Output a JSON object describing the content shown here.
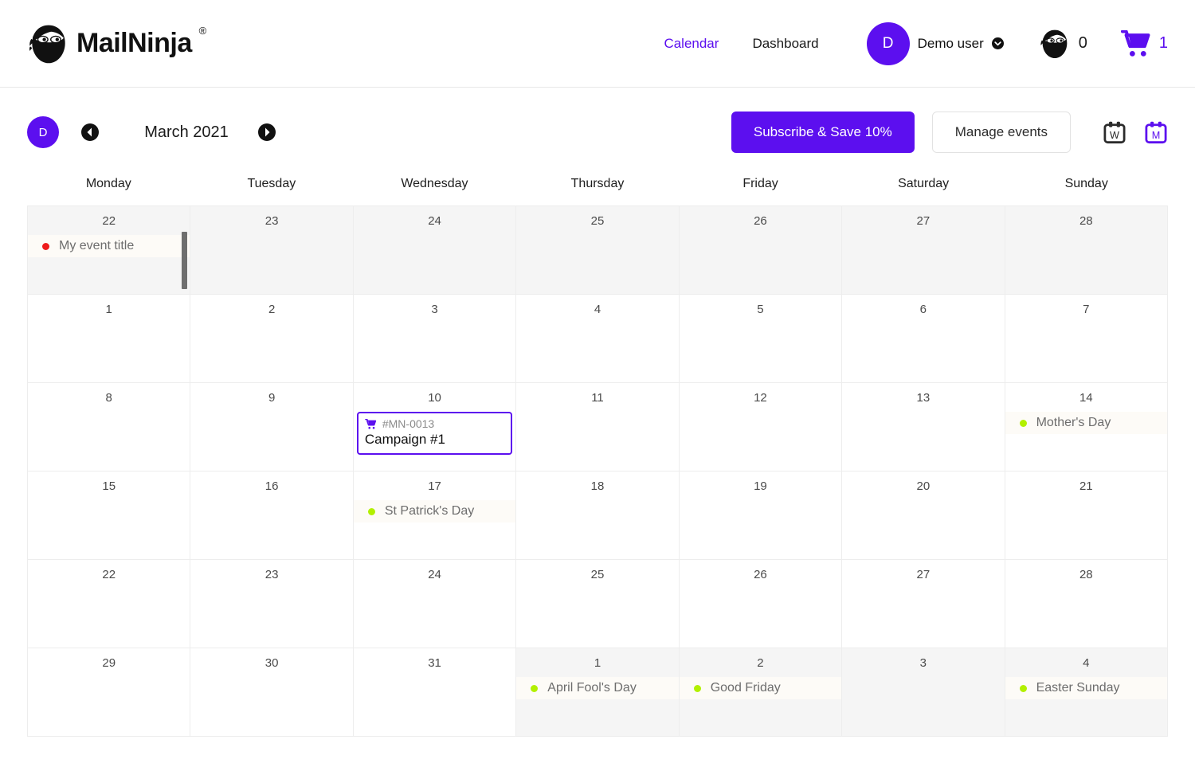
{
  "brand": {
    "name": "MailNinja",
    "trademark": "®",
    "accent": "#5c0fef"
  },
  "topnav": {
    "links": [
      {
        "label": "Calendar",
        "active": true
      },
      {
        "label": "Dashboard",
        "active": false
      }
    ],
    "avatar_initial": "D",
    "user_name": "Demo user",
    "ninja_count": "0",
    "cart_count": "1"
  },
  "toolbar": {
    "avatar_initial": "D",
    "prev_label": "Previous month",
    "next_label": "Next month",
    "month_title": "March 2021",
    "subscribe_label": "Subscribe & Save 10%",
    "manage_label": "Manage events",
    "week_view_letter": "W",
    "month_view_letter": "M",
    "active_view": "M"
  },
  "calendar": {
    "weekdays": [
      "Monday",
      "Tuesday",
      "Wednesday",
      "Thursday",
      "Friday",
      "Saturday",
      "Sunday"
    ],
    "weeks": [
      [
        {
          "num": "22",
          "muted": true,
          "scrollbar": true,
          "events": [
            {
              "kind": "holiday",
              "dot": "red",
              "title": "My event title"
            }
          ]
        },
        {
          "num": "23",
          "muted": true,
          "events": []
        },
        {
          "num": "24",
          "muted": true,
          "events": []
        },
        {
          "num": "25",
          "muted": true,
          "events": []
        },
        {
          "num": "26",
          "muted": true,
          "events": []
        },
        {
          "num": "27",
          "muted": true,
          "events": []
        },
        {
          "num": "28",
          "muted": true,
          "events": []
        }
      ],
      [
        {
          "num": "1",
          "muted": false,
          "events": []
        },
        {
          "num": "2",
          "muted": false,
          "events": []
        },
        {
          "num": "3",
          "muted": false,
          "events": []
        },
        {
          "num": "4",
          "muted": false,
          "events": []
        },
        {
          "num": "5",
          "muted": false,
          "events": []
        },
        {
          "num": "6",
          "muted": false,
          "events": []
        },
        {
          "num": "7",
          "muted": false,
          "events": []
        }
      ],
      [
        {
          "num": "8",
          "muted": false,
          "events": []
        },
        {
          "num": "9",
          "muted": false,
          "events": []
        },
        {
          "num": "10",
          "muted": false,
          "events": [
            {
              "kind": "campaign",
              "ref": "#MN-0013",
              "title": "Campaign #1"
            }
          ]
        },
        {
          "num": "11",
          "muted": false,
          "events": []
        },
        {
          "num": "12",
          "muted": false,
          "events": []
        },
        {
          "num": "13",
          "muted": false,
          "events": []
        },
        {
          "num": "14",
          "muted": false,
          "events": [
            {
              "kind": "holiday",
              "dot": "green",
              "title": "Mother's Day"
            }
          ]
        }
      ],
      [
        {
          "num": "15",
          "muted": false,
          "events": []
        },
        {
          "num": "16",
          "muted": false,
          "events": []
        },
        {
          "num": "17",
          "muted": false,
          "events": [
            {
              "kind": "holiday",
              "dot": "green",
              "title": "St Patrick's Day"
            }
          ]
        },
        {
          "num": "18",
          "muted": false,
          "events": []
        },
        {
          "num": "19",
          "muted": false,
          "events": []
        },
        {
          "num": "20",
          "muted": false,
          "events": []
        },
        {
          "num": "21",
          "muted": false,
          "events": []
        }
      ],
      [
        {
          "num": "22",
          "muted": false,
          "events": []
        },
        {
          "num": "23",
          "muted": false,
          "events": []
        },
        {
          "num": "24",
          "muted": false,
          "events": []
        },
        {
          "num": "25",
          "muted": false,
          "events": []
        },
        {
          "num": "26",
          "muted": false,
          "events": []
        },
        {
          "num": "27",
          "muted": false,
          "events": []
        },
        {
          "num": "28",
          "muted": false,
          "events": []
        }
      ],
      [
        {
          "num": "29",
          "muted": false,
          "events": []
        },
        {
          "num": "30",
          "muted": false,
          "events": []
        },
        {
          "num": "31",
          "muted": false,
          "events": []
        },
        {
          "num": "1",
          "muted": true,
          "events": [
            {
              "kind": "holiday",
              "dot": "green",
              "title": "April Fool's Day"
            }
          ]
        },
        {
          "num": "2",
          "muted": true,
          "events": [
            {
              "kind": "holiday",
              "dot": "green",
              "title": "Good Friday"
            }
          ]
        },
        {
          "num": "3",
          "muted": true,
          "events": []
        },
        {
          "num": "4",
          "muted": true,
          "events": [
            {
              "kind": "holiday",
              "dot": "green",
              "title": "Easter Sunday"
            }
          ]
        }
      ]
    ]
  }
}
